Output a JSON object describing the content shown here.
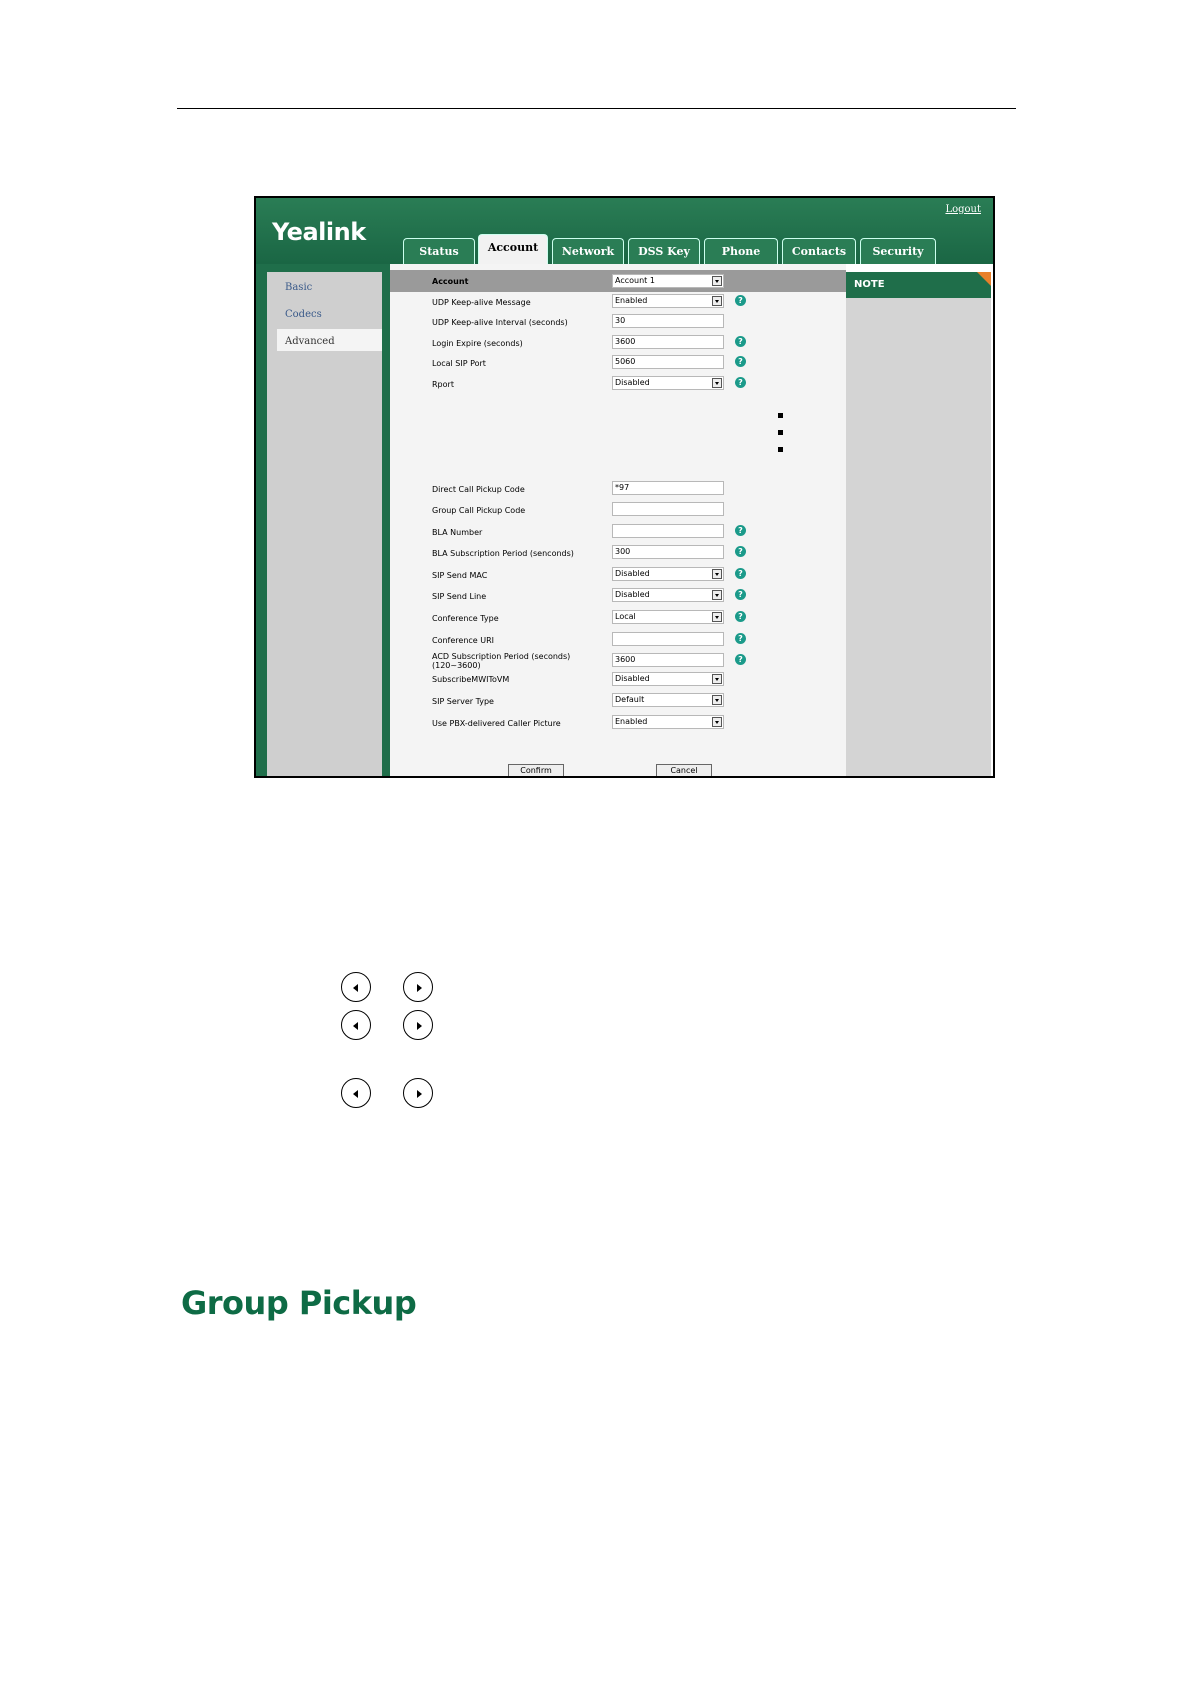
{
  "app": {
    "logo": "Yealink",
    "logout": "Logout"
  },
  "tabs": [
    "Status",
    "Account",
    "Network",
    "DSS Key",
    "Phone",
    "Contacts",
    "Security"
  ],
  "sidebar": {
    "items": [
      "Basic",
      "Codecs",
      "Advanced"
    ]
  },
  "note": {
    "title": "NOTE"
  },
  "form": {
    "account_label": "Account",
    "account_value": "Account 1",
    "rows": [
      {
        "label": "UDP Keep-alive Message",
        "value": "Enabled"
      },
      {
        "label": "UDP Keep-alive Interval (seconds)",
        "value": "30"
      },
      {
        "label": "Login Expire (seconds)",
        "value": "3600"
      },
      {
        "label": "Local SIP Port",
        "value": "5060"
      },
      {
        "label": "Rport",
        "value": "Disabled"
      },
      {
        "label": "Direct Call Pickup Code",
        "value": "*97"
      },
      {
        "label": "Group Call Pickup Code",
        "value": ""
      },
      {
        "label": "BLA Number",
        "value": ""
      },
      {
        "label": "BLA Subscription Period (senconds)",
        "value": "300"
      },
      {
        "label": "SIP Send MAC",
        "value": "Disabled"
      },
      {
        "label": "SIP Send Line",
        "value": "Disabled"
      },
      {
        "label": "Conference Type",
        "value": "Local"
      },
      {
        "label": "Conference URI",
        "value": ""
      },
      {
        "label": "ACD Subscription Period (seconds)",
        "label2": "(120~3600)",
        "value": "3600"
      },
      {
        "label": "SubscribeMWIToVM",
        "value": "Disabled"
      },
      {
        "label": "SIP Server Type",
        "value": "Default"
      },
      {
        "label": "Use PBX-delivered Caller Picture",
        "value": "Enabled"
      }
    ],
    "confirm": "Confirm",
    "cancel": "Cancel"
  },
  "section_heading": "Group Pickup"
}
